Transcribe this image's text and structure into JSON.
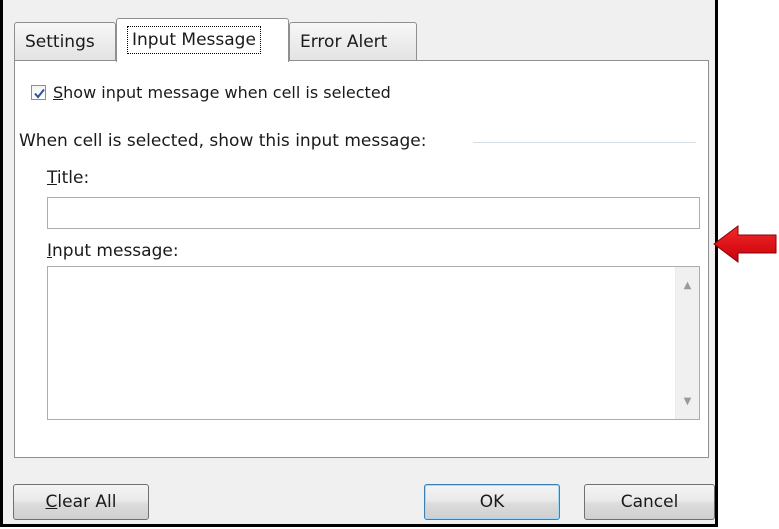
{
  "tabs": [
    {
      "label": "Settings"
    },
    {
      "label": "Input Message"
    },
    {
      "label": "Error Alert"
    }
  ],
  "checkbox": {
    "checked": true,
    "label_prefix": "S",
    "label_rest": "how input message when cell is selected"
  },
  "group": {
    "label": "When cell is selected, show this input message:"
  },
  "title_field": {
    "label_prefix": "T",
    "label_rest": "itle:",
    "value": ""
  },
  "message_field": {
    "label_prefix": "I",
    "label_rest": "nput message:",
    "value": ""
  },
  "buttons": {
    "clear_prefix": "C",
    "clear_rest": "lear All",
    "ok": "OK",
    "cancel": "Cancel"
  },
  "colors": {
    "arrow": "#e30613"
  }
}
